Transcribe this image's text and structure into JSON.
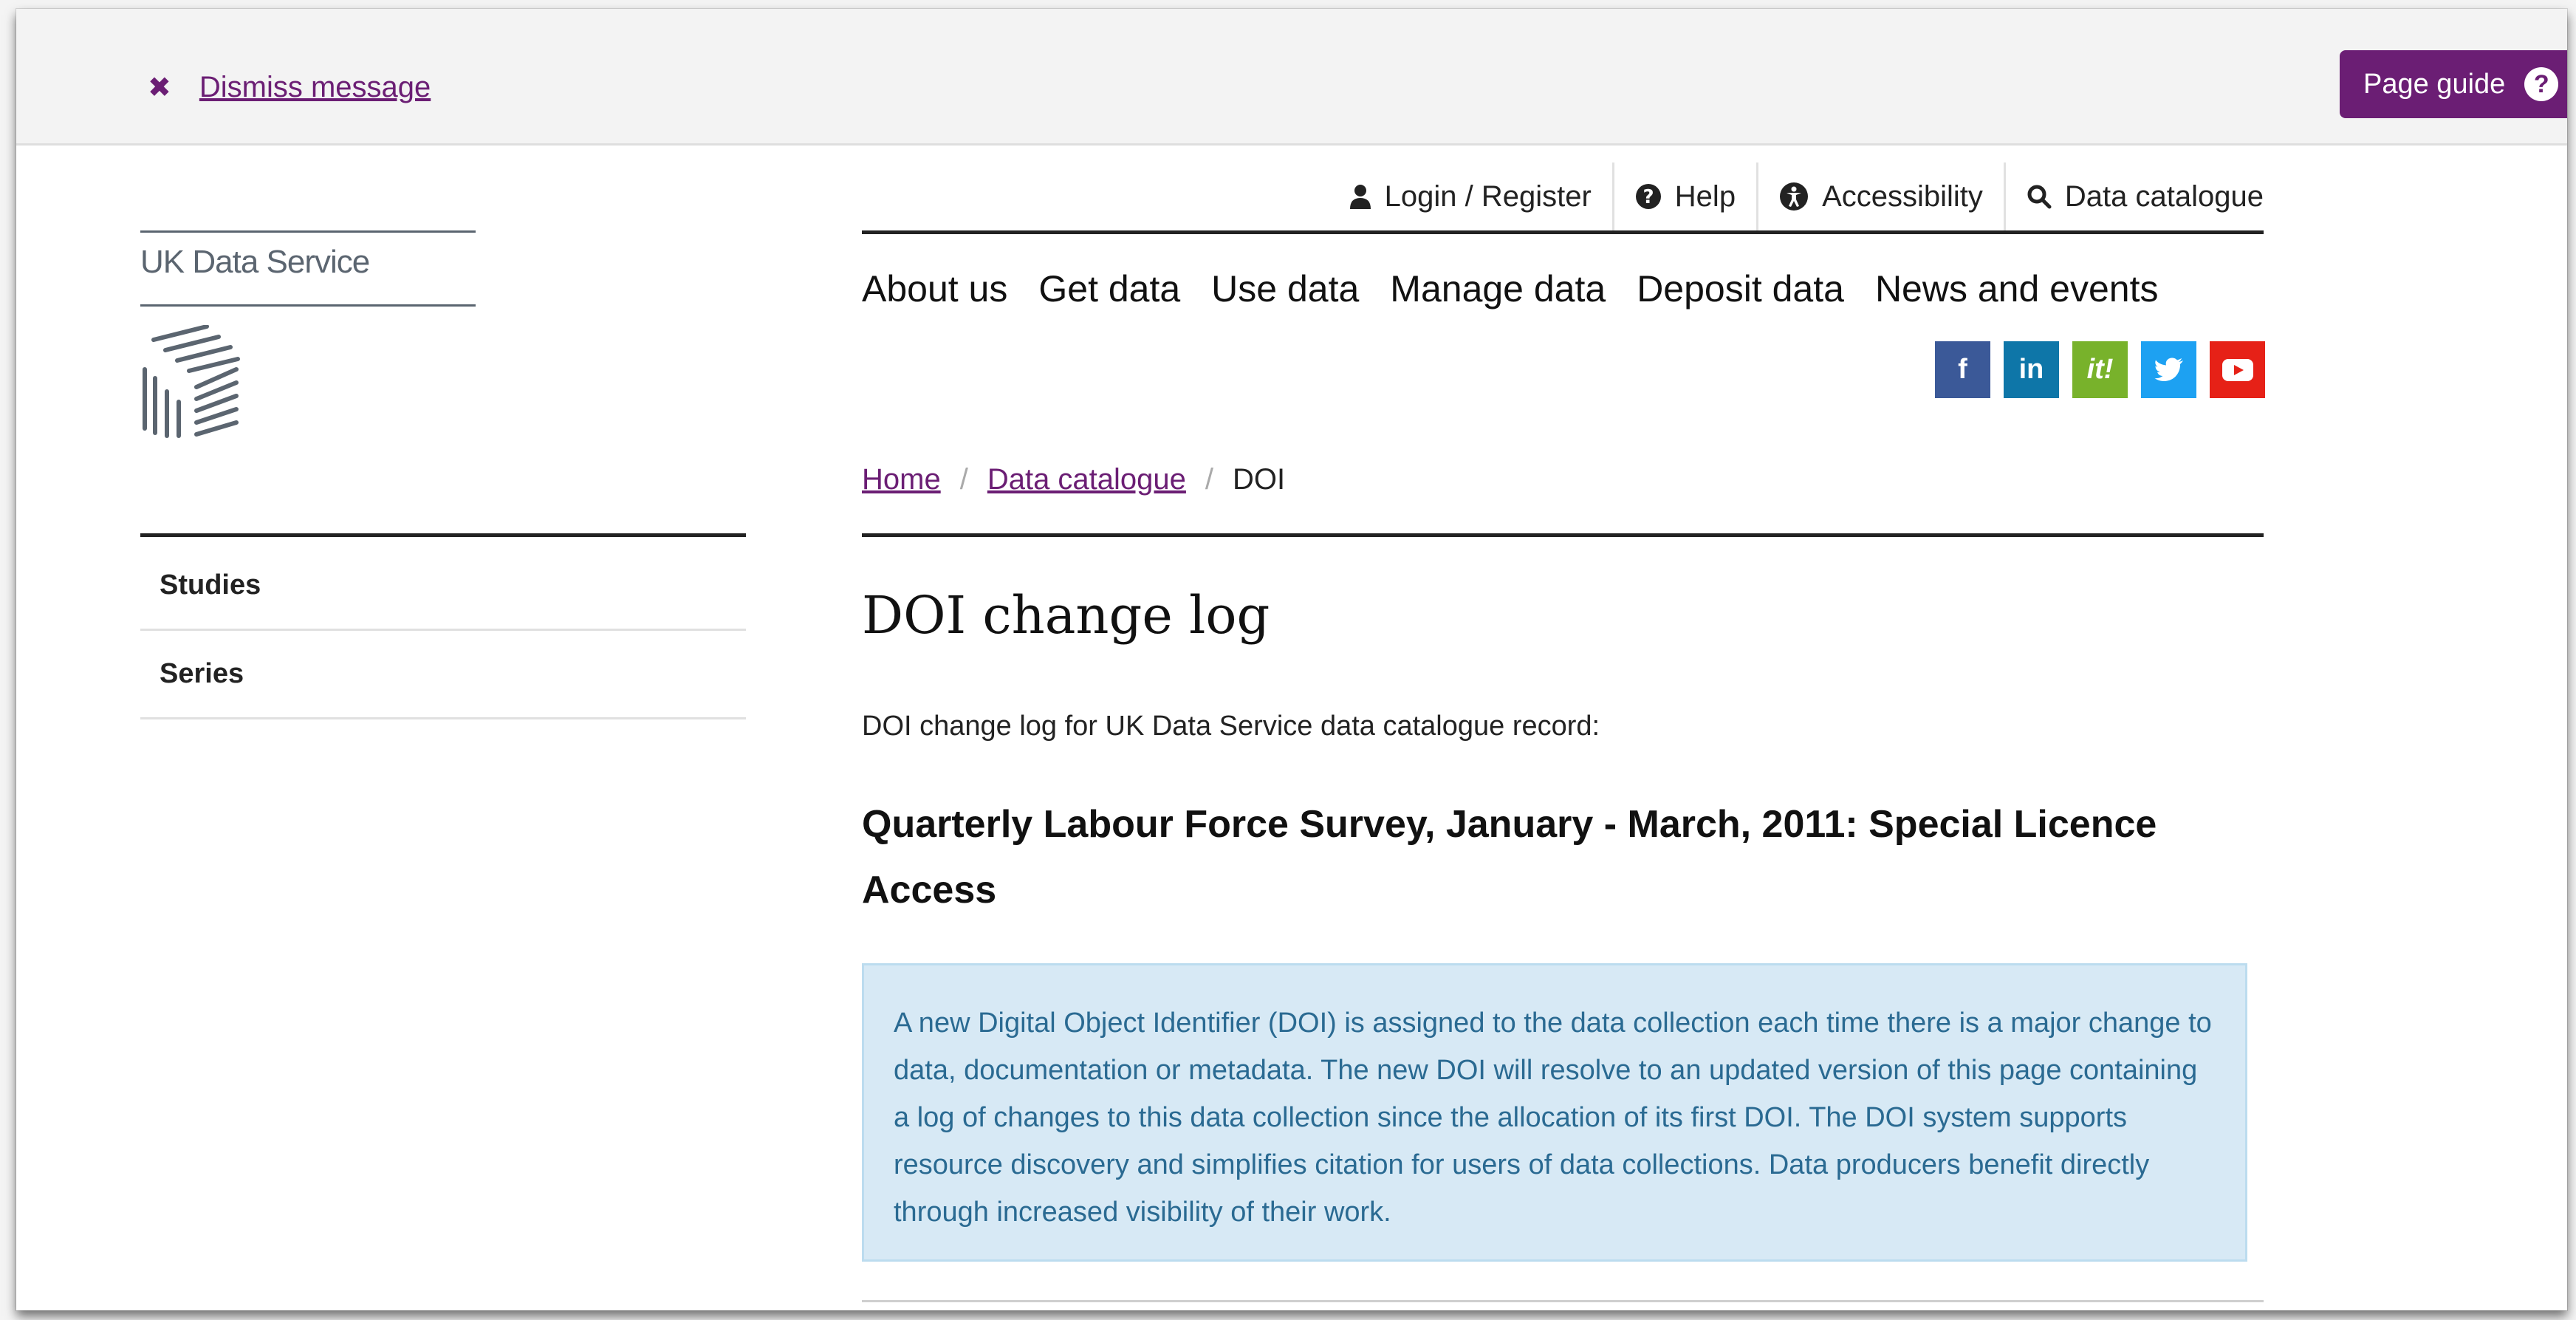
{
  "message_bar": {
    "dismiss_label": "Dismiss message",
    "page_guide_label": "Page guide"
  },
  "utility_nav": {
    "items": [
      {
        "label": "Login / Register",
        "icon": "user-icon"
      },
      {
        "label": "Help",
        "icon": "help-circle-icon"
      },
      {
        "label": "Accessibility",
        "icon": "accessibility-icon"
      },
      {
        "label": "Data catalogue",
        "icon": "search-icon"
      }
    ]
  },
  "main_nav": {
    "items": [
      "About us",
      "Get data",
      "Use data",
      "Manage data",
      "Deposit data",
      "News and events"
    ]
  },
  "social": [
    {
      "name": "facebook",
      "glyph": "f",
      "color": "#3b5998"
    },
    {
      "name": "linkedin",
      "glyph": "in",
      "color": "#0e76a8"
    },
    {
      "name": "iti",
      "glyph": "it!",
      "color": "#78b22b"
    },
    {
      "name": "twitter",
      "glyph": "t",
      "color": "#1da1f2"
    },
    {
      "name": "youtube",
      "glyph": "▶",
      "color": "#e62117"
    }
  ],
  "logo": {
    "text": "UK Data Service"
  },
  "sidebar": {
    "items": [
      "Studies",
      "Series"
    ]
  },
  "breadcrumb": {
    "home": "Home",
    "catalogue": "Data catalogue",
    "current": "DOI"
  },
  "page": {
    "title": "DOI change log",
    "intro": "DOI change log for UK Data Service data catalogue record:",
    "study_title": "Quarterly Labour Force Survey, January - March, 2011: Special Licence Access",
    "info_text": "A new Digital Object Identifier (DOI) is assigned to the data collection each time there is a major change to data, documentation or metadata. The new DOI will resolve to an updated version of this page containing a log of changes to this data collection since the allocation of its first DOI. The DOI system supports resource discovery and simplifies citation for users of data collections. Data producers benefit directly through increased visibility of their work."
  },
  "colors": {
    "accent": "#6b1e74",
    "info_bg": "#d7e9f5",
    "info_text": "#2a6a92"
  }
}
